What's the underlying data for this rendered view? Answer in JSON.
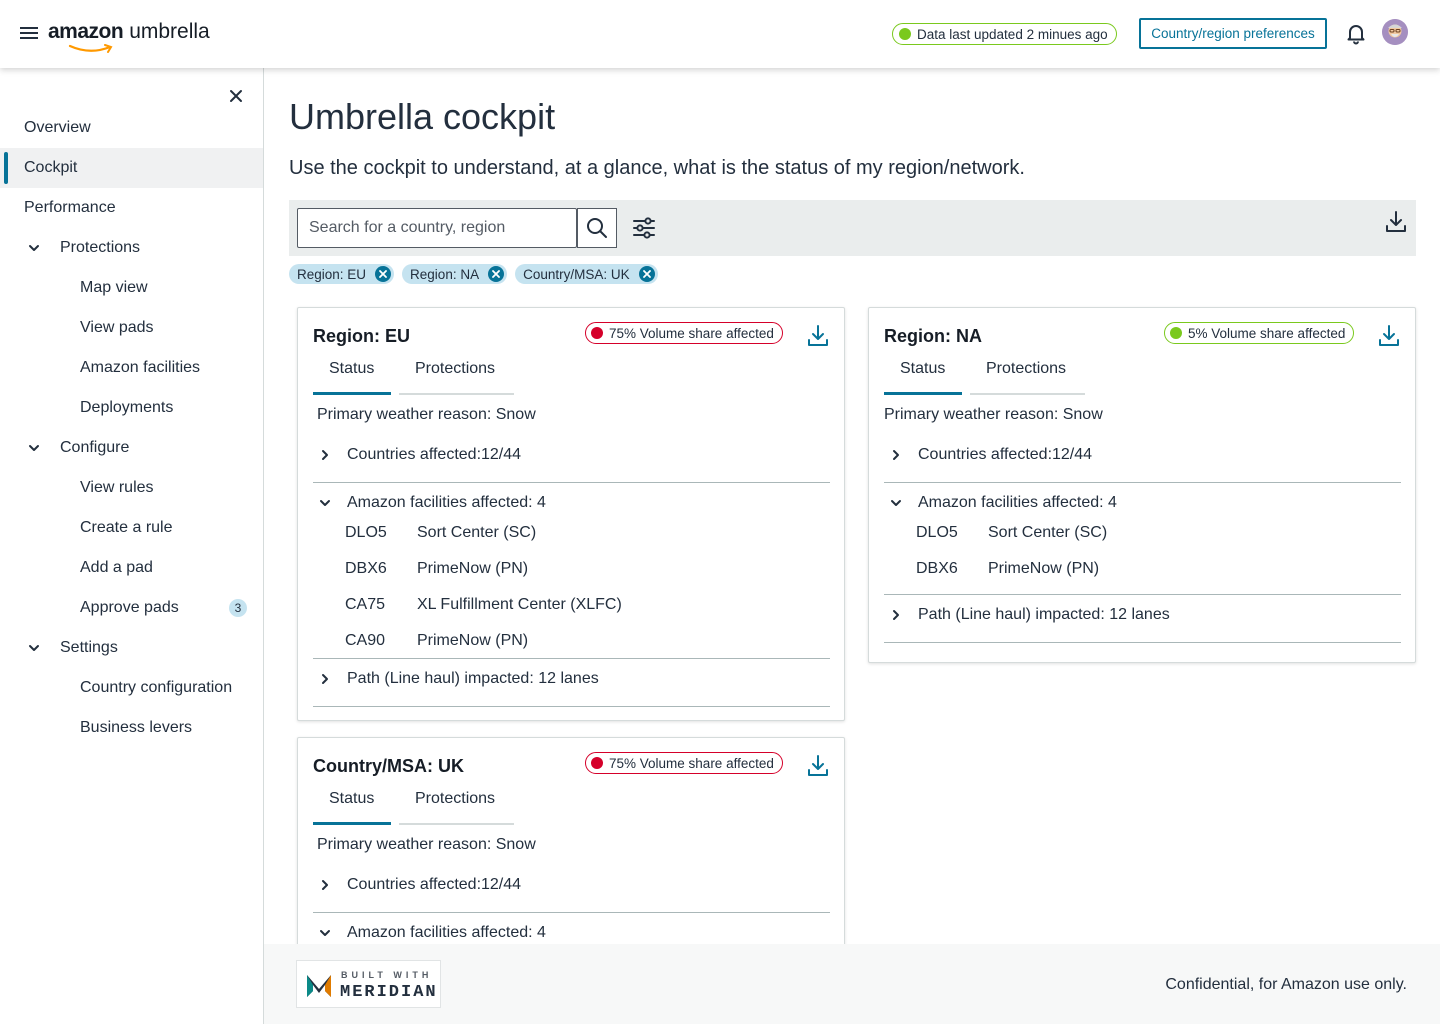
{
  "header": {
    "logo_brand": "amazon",
    "logo_product": "umbrella",
    "updated_text": "Data last updated 2 minues ago",
    "prefs_label": "Country/region preferences",
    "status_color": "#7ac91d",
    "accent_color": "#077398"
  },
  "sidebar": {
    "items": [
      {
        "label": "Overview"
      },
      {
        "label": "Cockpit"
      },
      {
        "label": "Performance"
      },
      {
        "label": "Protections"
      },
      {
        "label": "Map view"
      },
      {
        "label": "View pads"
      },
      {
        "label": "Amazon facilities"
      },
      {
        "label": "Deployments"
      },
      {
        "label": "Configure"
      },
      {
        "label": "View rules"
      },
      {
        "label": "Create a rule"
      },
      {
        "label": "Add a pad"
      },
      {
        "label": "Approve pads",
        "badge": "3"
      },
      {
        "label": "Settings"
      },
      {
        "label": "Country configuration"
      },
      {
        "label": "Business levers"
      }
    ]
  },
  "main": {
    "title": "Umbrella cockpit",
    "subtitle": "Use the cockpit to understand, at a glance, what is the status of my region/network.",
    "search_placeholder": "Search for a country, region",
    "chips": [
      "Region: EU",
      "Region: NA",
      "Country/MSA: UK"
    ]
  },
  "cards": [
    {
      "title": "Region: EU",
      "volume": "75% Volume share affected",
      "volume_color": "#d5002a",
      "tabs": [
        "Status",
        "Protections"
      ],
      "reason": "Primary weather reason: Snow",
      "countries": "Countries affected:12/44",
      "facilities_label": "Amazon facilities affected: 4",
      "facilities": [
        {
          "code": "DLO5",
          "type": "Sort Center (SC)"
        },
        {
          "code": "DBX6",
          "type": "PrimeNow (PN)"
        },
        {
          "code": "CA75",
          "type": "XL Fulfillment Center (XLFC)"
        },
        {
          "code": "CA90",
          "type": "PrimeNow (PN)"
        }
      ],
      "path": "Path (Line haul) impacted: 12 lanes"
    },
    {
      "title": "Region: NA",
      "volume": "5% Volume share affected",
      "volume_color": "#7ac91d",
      "tabs": [
        "Status",
        "Protections"
      ],
      "reason": "Primary weather reason: Snow",
      "countries": "Countries affected:12/44",
      "facilities_label": "Amazon facilities affected: 4",
      "facilities": [
        {
          "code": "DLO5",
          "type": "Sort Center (SC)"
        },
        {
          "code": "DBX6",
          "type": "PrimeNow (PN)"
        }
      ],
      "path": "Path (Line haul) impacted: 12 lanes"
    },
    {
      "title": "Country/MSA: UK",
      "volume": "75% Volume share affected",
      "volume_color": "#d5002a",
      "tabs": [
        "Status",
        "Protections"
      ],
      "reason": "Primary weather reason: Snow",
      "countries": "Countries affected:12/44",
      "facilities_label": "Amazon facilities affected: 4"
    }
  ],
  "footer": {
    "built_with": "BUILT WITH",
    "meridian": "MERIDIAN",
    "confidential": "Confidential, for Amazon use only."
  }
}
